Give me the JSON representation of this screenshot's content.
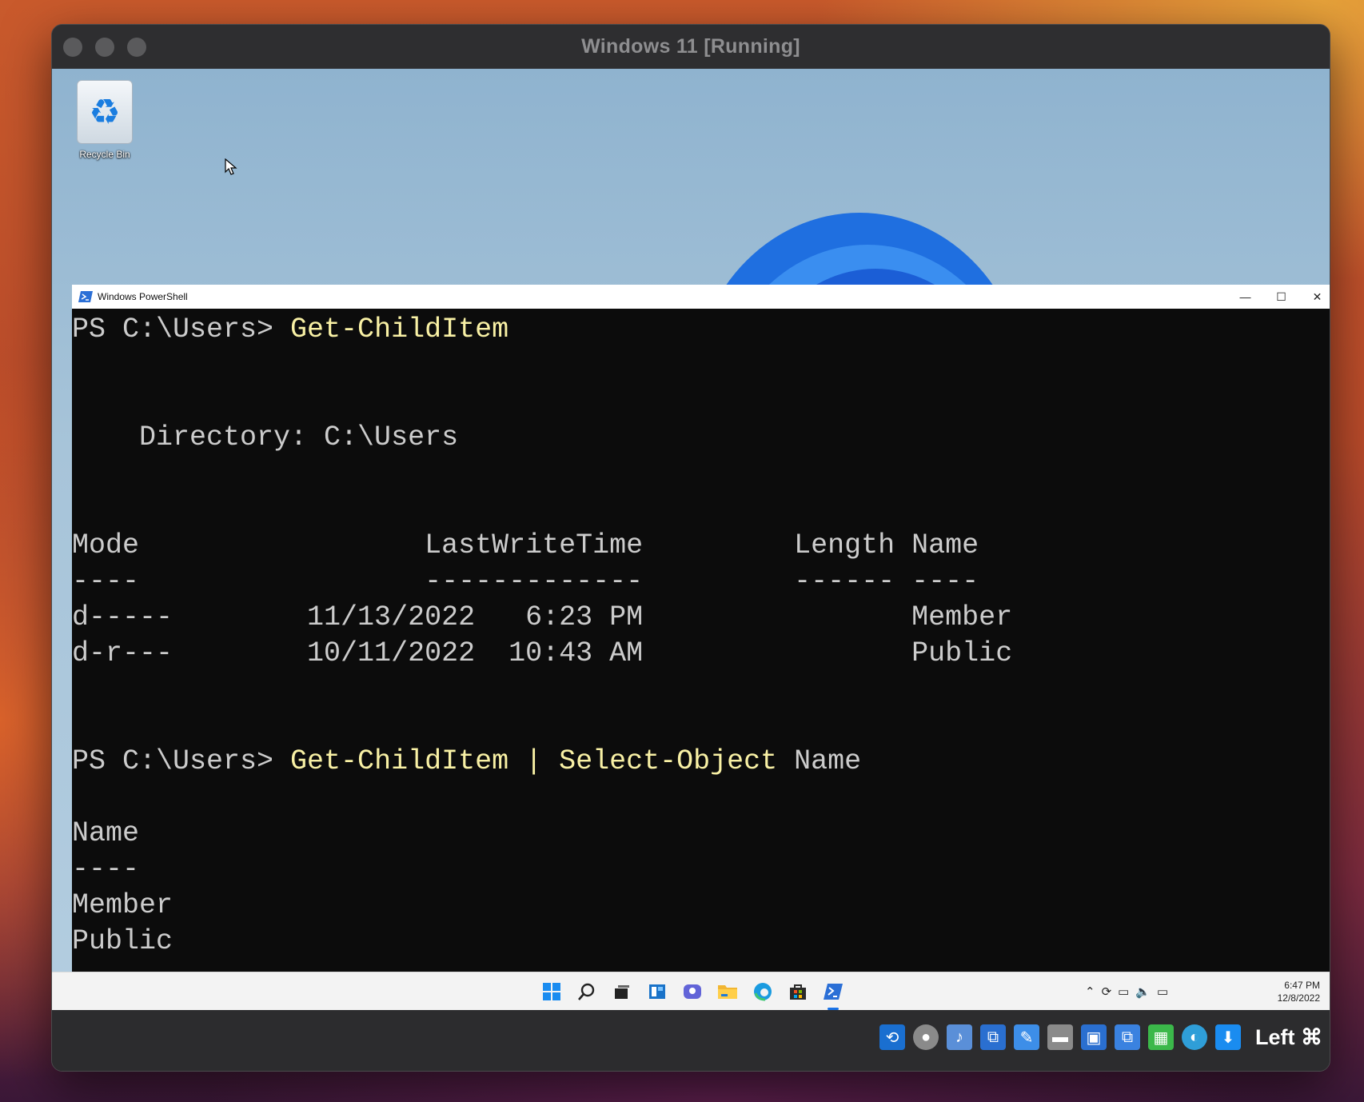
{
  "vm": {
    "title": "Windows 11 [Running]",
    "host_key": "Left ⌘"
  },
  "desktop": {
    "recycle_bin_label": "Recycle Bin"
  },
  "powershell": {
    "title": "Windows PowerShell",
    "lines": [
      {
        "prompt": "PS C:\\Users> ",
        "command": "Get-ChildItem",
        "rest": ""
      },
      {
        "text": ""
      },
      {
        "text": ""
      },
      {
        "text": "    Directory: C:\\Users"
      },
      {
        "text": ""
      },
      {
        "text": ""
      },
      {
        "text": "Mode                 LastWriteTime         Length Name"
      },
      {
        "text": "----                 -------------         ------ ----"
      },
      {
        "text": "d-----        11/13/2022   6:23 PM                Member"
      },
      {
        "text": "d-r---        10/11/2022  10:43 AM                Public"
      },
      {
        "text": ""
      },
      {
        "text": ""
      },
      {
        "prompt": "PS C:\\Users> ",
        "command": "Get-ChildItem | Select-Object",
        "rest": " Name"
      },
      {
        "text": ""
      },
      {
        "text": "Name"
      },
      {
        "text": "----"
      },
      {
        "text": "Member"
      },
      {
        "text": "Public"
      }
    ]
  },
  "taskbar": {
    "apps": [
      "start-icon",
      "search-icon",
      "task-view-icon",
      "widgets-icon",
      "chat-icon",
      "file-explorer-icon",
      "edge-icon",
      "store-icon",
      "powershell-icon"
    ],
    "clock_time": "6:47 PM",
    "clock_date": "12/8/2022"
  }
}
